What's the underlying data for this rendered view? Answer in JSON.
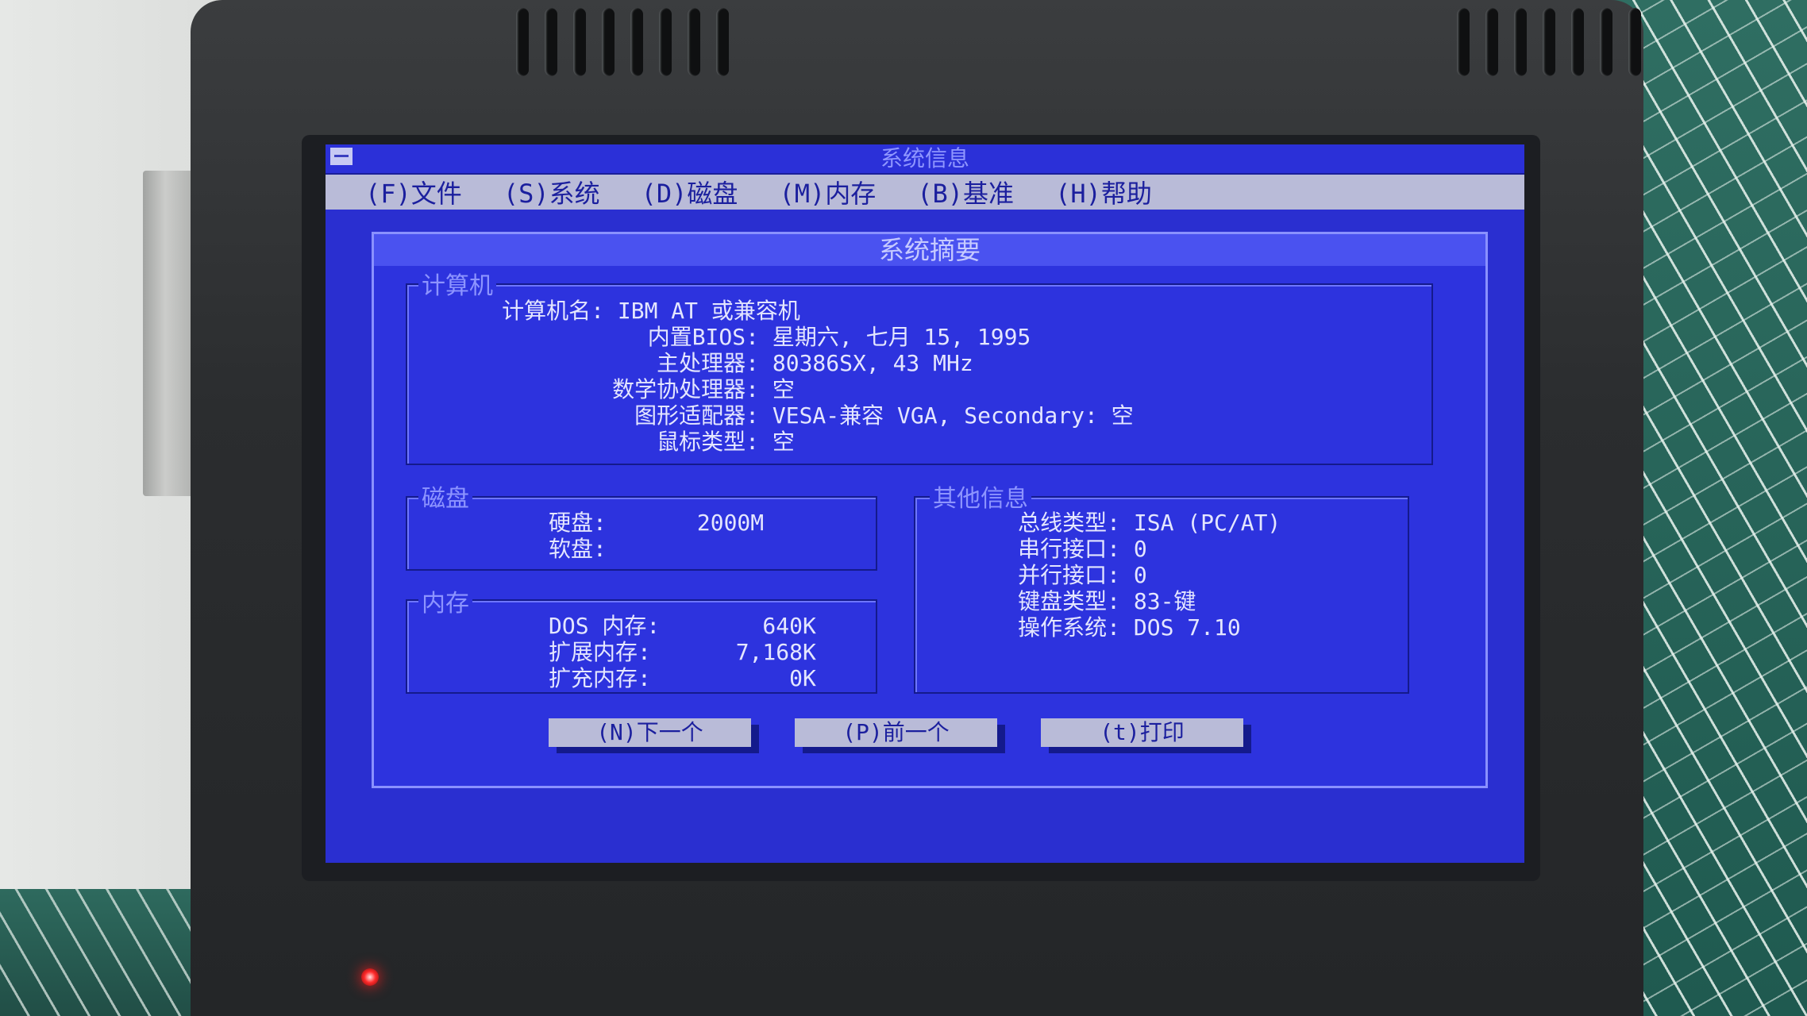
{
  "window": {
    "title": "系统信息"
  },
  "menu": [
    "(F)文件",
    "(S)系统",
    "(D)磁盘",
    "(M)内存",
    "(B)基准",
    "(H)帮助"
  ],
  "dialog": {
    "title": "系统摘要",
    "computer": {
      "label": "计算机",
      "rows": [
        {
          "k": "计算机名:",
          "v": "IBM AT 或兼容机"
        },
        {
          "k": "内置BIOS:",
          "v": "星期六, 七月 15, 1995"
        },
        {
          "k": "主处理器:",
          "v": "80386SX, 43 MHz"
        },
        {
          "k": "数学协处理器:",
          "v": "空"
        },
        {
          "k": "图形适配器:",
          "v": "VESA-兼容 VGA, Secondary: 空"
        },
        {
          "k": "鼠标类型:",
          "v": "空"
        }
      ]
    },
    "disk": {
      "label": "磁盘",
      "rows": [
        {
          "k": "硬盘:",
          "v": "2000M"
        },
        {
          "k": "软盘:",
          "v": ""
        }
      ]
    },
    "memory": {
      "label": "内存",
      "rows": [
        {
          "k": "DOS 内存:",
          "v": "640K"
        },
        {
          "k": "扩展内存:",
          "v": "7,168K"
        },
        {
          "k": "扩充内存:",
          "v": "0K"
        }
      ]
    },
    "other": {
      "label": "其他信息",
      "rows": [
        {
          "k": "总线类型:",
          "v": "ISA (PC/AT)"
        },
        {
          "k": "串行接口:",
          "v": "0"
        },
        {
          "k": "并行接口:",
          "v": "0"
        },
        {
          "k": "键盘类型:",
          "v": "83-键"
        },
        {
          "k": "操作系统:",
          "v": "DOS 7.10"
        }
      ]
    },
    "buttons": {
      "next": "(N)下一个",
      "prev": "(P)前一个",
      "print": "(t)打印"
    }
  },
  "colors": {
    "screen_blue": "#2a2fd0",
    "menu_gray": "#b9bbd8",
    "led_red": "#ff2a2a"
  }
}
